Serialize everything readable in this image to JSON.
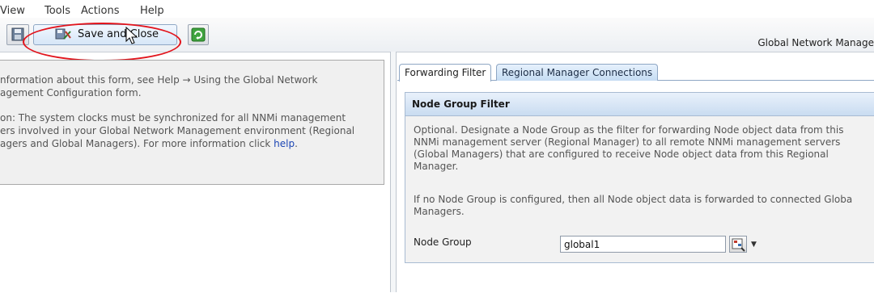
{
  "menubar": {
    "items": [
      "View",
      "Tools",
      "Actions",
      "Help"
    ]
  },
  "toolbar": {
    "save_close_label": "Save and Close",
    "window_title": "Global Network Manage"
  },
  "info": {
    "line1": "nformation about this form, see Help → Using the Global Network",
    "line2": "agement Configuration form.",
    "line3": "on: The system clocks must be synchronized for all NNMi management",
    "line4": "ers involved in your Global Network Management environment (Regional",
    "line5_pre": "agers and Global Managers). For more information click ",
    "link": "help",
    "line5_post": "."
  },
  "tabs": [
    {
      "label": "Forwarding Filter"
    },
    {
      "label": "Regional Manager Connections"
    }
  ],
  "group": {
    "title": "Node Group Filter",
    "desc1": [
      "Optional. Designate a Node Group as the filter for forwarding Node object data from this",
      "NNMi management server (Regional Manager) to all remote NNMi management servers",
      "(Global Managers) that are configured to receive Node object data from this Regional",
      "Manager."
    ],
    "desc2": [
      "If no Node Group is configured, then all Node object data is forwarded to connected Globa",
      "Managers."
    ],
    "field_label": "Node Group",
    "field_value": "global1"
  },
  "colors": {
    "annotation_circle": "#e2141c",
    "link": "#1c46b4"
  }
}
